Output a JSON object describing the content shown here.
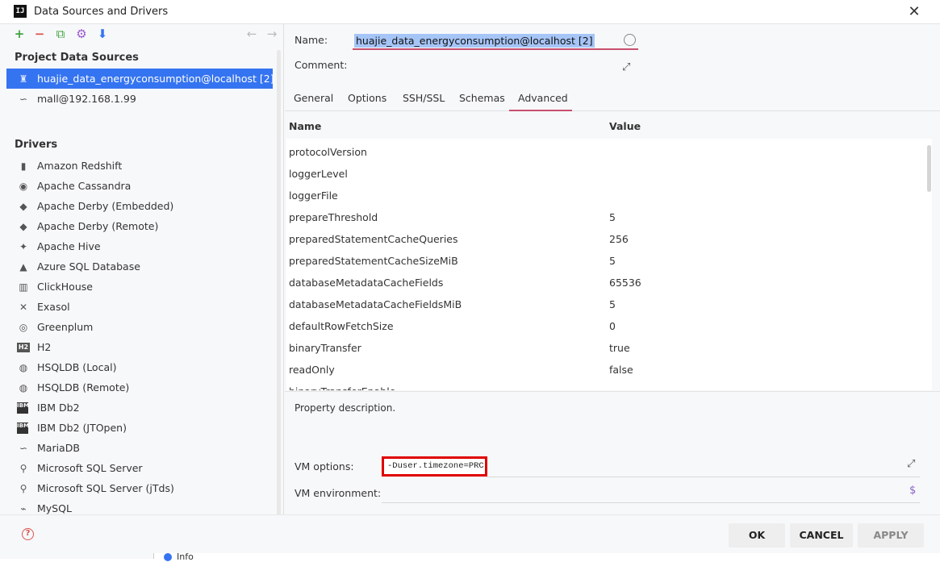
{
  "window": {
    "title": "Data Sources and Drivers",
    "app_icon": "IJ"
  },
  "toolbar": {
    "add": "+",
    "remove": "−",
    "copy": "⧉",
    "settings": "⚙",
    "import": "⬇",
    "back": "←",
    "forward": "→"
  },
  "left": {
    "project_sources_header": "Project Data Sources",
    "project_sources": [
      {
        "label": "huajie_data_energyconsumption@localhost [2]",
        "icon": "postgres-elephant-icon"
      },
      {
        "label": "mall@192.168.1.99",
        "icon": "mariadb-seal-icon"
      }
    ],
    "drivers_header": "Drivers",
    "drivers": [
      {
        "label": "Amazon Redshift",
        "icon": "redshift-icon",
        "glyph": "▮"
      },
      {
        "label": "Apache Cassandra",
        "icon": "cassandra-eye-icon",
        "glyph": "◉"
      },
      {
        "label": "Apache Derby (Embedded)",
        "icon": "derby-hat-icon",
        "glyph": "◆"
      },
      {
        "label": "Apache Derby (Remote)",
        "icon": "derby-hat-icon",
        "glyph": "◆"
      },
      {
        "label": "Apache Hive",
        "icon": "hive-bee-icon",
        "glyph": "✦"
      },
      {
        "label": "Azure SQL Database",
        "icon": "azure-icon",
        "glyph": "▲"
      },
      {
        "label": "ClickHouse",
        "icon": "clickhouse-bars-icon",
        "glyph": "▥"
      },
      {
        "label": "Exasol",
        "icon": "exasol-x-icon",
        "glyph": "✕"
      },
      {
        "label": "Greenplum",
        "icon": "greenplum-circle-icon",
        "glyph": "◎"
      },
      {
        "label": "H2",
        "icon": "h2-icon",
        "glyph": "H2"
      },
      {
        "label": "HSQLDB (Local)",
        "icon": "hsqldb-icon",
        "glyph": "◍"
      },
      {
        "label": "HSQLDB (Remote)",
        "icon": "hsqldb-icon",
        "glyph": "◍"
      },
      {
        "label": "IBM Db2",
        "icon": "ibm-db2-icon",
        "glyph": "IBM"
      },
      {
        "label": "IBM Db2 (JTOpen)",
        "icon": "ibm-db2-icon",
        "glyph": "IBM"
      },
      {
        "label": "MariaDB",
        "icon": "mariadb-seal-icon",
        "glyph": "∽"
      },
      {
        "label": "Microsoft SQL Server",
        "icon": "sqlserver-icon",
        "glyph": "⚲"
      },
      {
        "label": "Microsoft SQL Server (jTds)",
        "icon": "sqlserver-icon",
        "glyph": "⚲"
      },
      {
        "label": "MySQL",
        "icon": "mysql-dolphin-icon",
        "glyph": "⌁"
      }
    ]
  },
  "form": {
    "name_label": "Name:",
    "name_value": "huajie_data_energyconsumption@localhost [2]",
    "comment_label": "Comment:"
  },
  "tabs": [
    "General",
    "Options",
    "SSH/SSL",
    "Schemas",
    "Advanced"
  ],
  "active_tab": "Advanced",
  "table": {
    "headers": {
      "name": "Name",
      "value": "Value"
    },
    "rows": [
      {
        "name": "protocolVersion",
        "value": ""
      },
      {
        "name": "loggerLevel",
        "value": ""
      },
      {
        "name": "loggerFile",
        "value": ""
      },
      {
        "name": "prepareThreshold",
        "value": "5"
      },
      {
        "name": "preparedStatementCacheQueries",
        "value": "256"
      },
      {
        "name": "preparedStatementCacheSizeMiB",
        "value": "5"
      },
      {
        "name": "databaseMetadataCacheFields",
        "value": "65536"
      },
      {
        "name": "databaseMetadataCacheFieldsMiB",
        "value": "5"
      },
      {
        "name": "defaultRowFetchSize",
        "value": "0"
      },
      {
        "name": "binaryTransfer",
        "value": "true"
      },
      {
        "name": "readOnly",
        "value": "false"
      },
      {
        "name": "binaryTransferEnable",
        "value": ""
      }
    ]
  },
  "description": "Property description.",
  "vm": {
    "options_label": "VM options:",
    "options_value": "-Duser.timezone=PRC",
    "environment_label": "VM environment:"
  },
  "buttons": {
    "ok": "OK",
    "cancel": "CANCEL",
    "apply": "APPLY",
    "help": "?"
  },
  "behind": {
    "info_label": "Info"
  },
  "colors": {
    "accent": "#3574f0",
    "tab_underline": "#c94f6d",
    "highlight_box": "#e00000"
  }
}
